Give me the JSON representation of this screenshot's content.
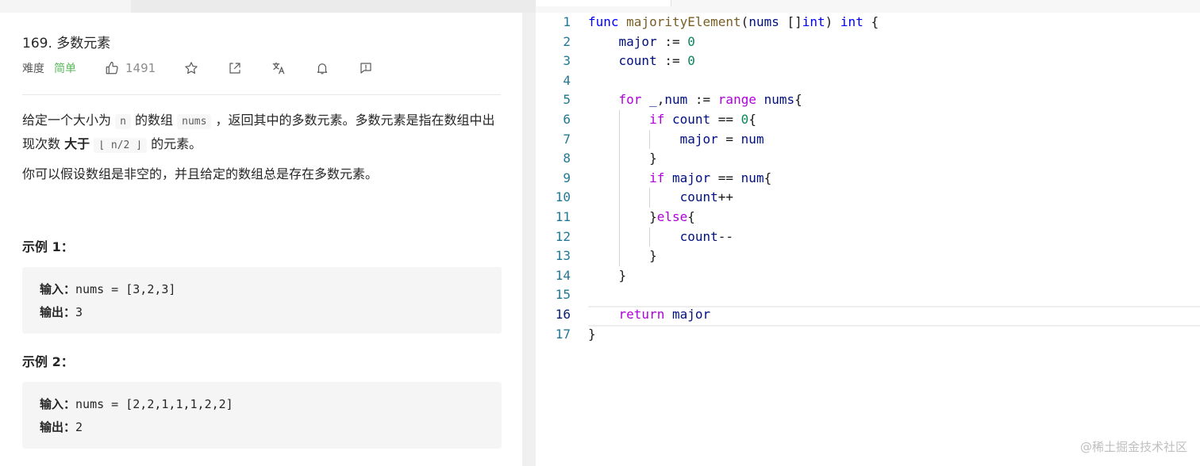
{
  "problem": {
    "title": "169. 多数元素",
    "difficulty_label": "难度",
    "difficulty": "简单",
    "like_count": "1491",
    "description": {
      "p1_a": "给定一个大小为",
      "p1_code_n": "n",
      "p1_b": "的数组",
      "p1_code_nums": "nums",
      "p1_c": "，返回其中的多数元素。多数元素是指在数组中出现次数",
      "p1_bold": "大于",
      "p1_code_floor": "⌊ n/2 ⌋",
      "p1_d": "的元素。",
      "p2": "你可以假设数组是非空的，并且给定的数组总是存在多数元素。"
    },
    "examples": [
      {
        "title": "示例 1：",
        "input_label": "输入：",
        "input": "nums = [3,2,3]",
        "output_label": "输出：",
        "output": "3"
      },
      {
        "title": "示例 2：",
        "input_label": "输入：",
        "input": "nums = [2,2,1,1,1,2,2]",
        "output_label": "输出：",
        "output": "2"
      }
    ]
  },
  "editor": {
    "line_numbers": [
      "1",
      "2",
      "3",
      "4",
      "5",
      "6",
      "7",
      "8",
      "9",
      "10",
      "11",
      "12",
      "13",
      "14",
      "15",
      "16",
      "17"
    ],
    "current_line": "16",
    "code_lines": [
      "func majorityElement(nums []int) int {",
      "    major := 0",
      "    count := 0",
      "",
      "    for _,num := range nums{",
      "        if count == 0{",
      "            major = num",
      "        }",
      "        if major == num{",
      "            count++",
      "        }else{",
      "            count--",
      "        }",
      "    }",
      "",
      "    return major",
      "}"
    ]
  },
  "watermark": "@稀土掘金技术社区",
  "icons": [
    "thumbs-up-icon",
    "star-icon",
    "share-icon",
    "translate-icon",
    "bell-icon",
    "feedback-icon"
  ],
  "colors": {
    "difficulty_easy": "#5cb85c",
    "keyword": "#af00db",
    "keyword_blue": "#0000ff",
    "type": "#267f99",
    "number": "#098658",
    "line_number": "#237893"
  }
}
